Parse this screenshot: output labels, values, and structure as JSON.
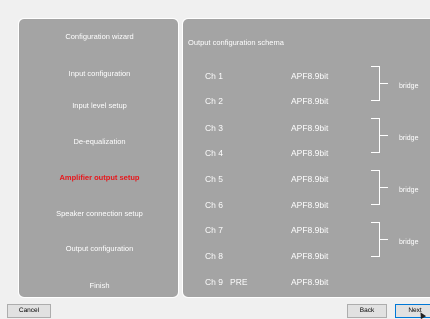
{
  "steps": [
    {
      "label": "Configuration wizard"
    },
    {
      "label": "Input configuration"
    },
    {
      "label": "Input level setup"
    },
    {
      "label": "De-equalization"
    },
    {
      "label": "Amplifier output setup",
      "active": true
    },
    {
      "label": "Speaker connection setup"
    },
    {
      "label": "Output configuration"
    },
    {
      "label": "Finish"
    }
  ],
  "schema": {
    "title": "Output configuration schema",
    "channels": [
      {
        "name": "Ch 1",
        "value": "APF8.9bit"
      },
      {
        "name": "Ch 2",
        "value": "APF8.9bit"
      },
      {
        "name": "Ch 3",
        "value": "APF8.9bit"
      },
      {
        "name": "Ch 4",
        "value": "APF8.9bit"
      },
      {
        "name": "Ch 5",
        "value": "APF8.9bit"
      },
      {
        "name": "Ch 6",
        "value": "APF8.9bit"
      },
      {
        "name": "Ch 7",
        "value": "APF8.9bit"
      },
      {
        "name": "Ch 8",
        "value": "APF8.9bit"
      },
      {
        "name": "Ch 9   PRE",
        "value": "APF8.9bit"
      }
    ],
    "bridges": [
      {
        "label": "bridge"
      },
      {
        "label": "bridge"
      },
      {
        "label": "bridge"
      },
      {
        "label": "bridge"
      }
    ]
  },
  "buttons": {
    "cancel": "Cancel",
    "back": "Back",
    "next": "Next"
  },
  "colors": {
    "panel": "#a4a4a4",
    "active_step": "#e8161b",
    "window_bg": "#f0f0f0"
  }
}
